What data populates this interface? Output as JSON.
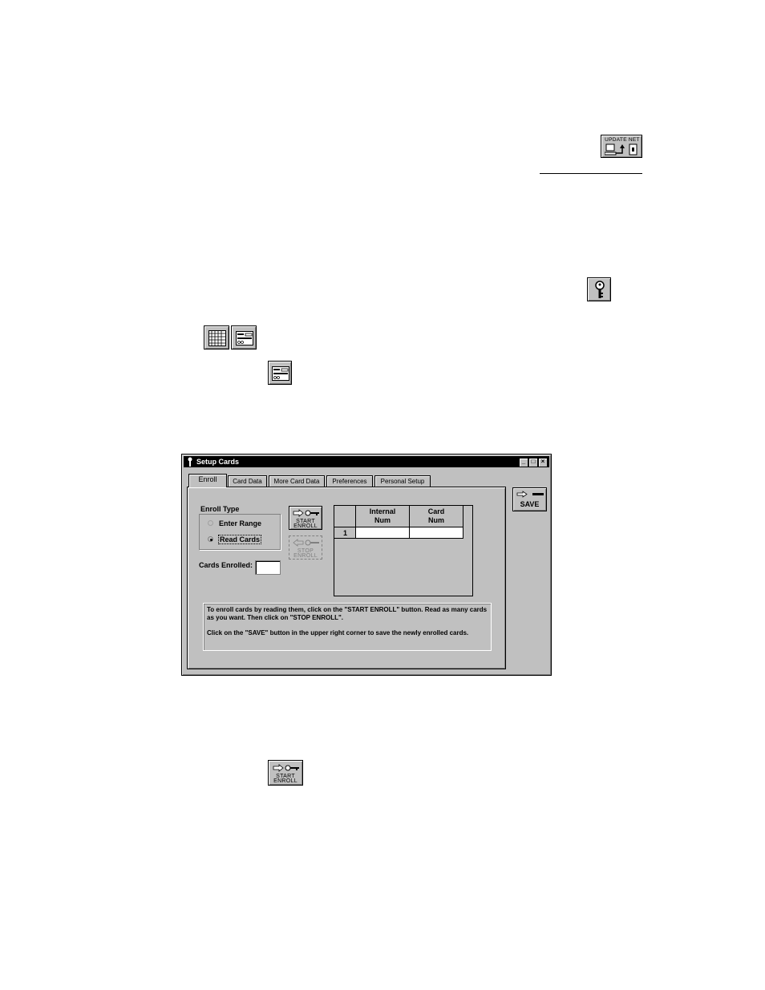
{
  "icons": {
    "update_net_label": "UPDATE NET",
    "start_enroll_line1": "START",
    "start_enroll_line2": "ENROLL"
  },
  "window": {
    "title": "Setup Cards",
    "controls": {
      "minimize": "_",
      "maximize": "□",
      "close": "×"
    },
    "tabs": [
      {
        "label": "Enroll"
      },
      {
        "label": "Card Data"
      },
      {
        "label": "More Card Data"
      },
      {
        "label": "Preferences"
      },
      {
        "label": "Personal Setup"
      }
    ],
    "save_label": "SAVE",
    "enroll_type": {
      "title": "Enroll Type",
      "options": [
        {
          "label": "Enter Range",
          "selected": false
        },
        {
          "label": "Read Cards",
          "selected": true
        }
      ]
    },
    "start_enroll": {
      "line1": "START",
      "line2": "ENROLL"
    },
    "stop_enroll": {
      "line1": "STOP",
      "line2": "ENROLL"
    },
    "cards_enrolled": {
      "label": "Cards Enrolled:",
      "value": ""
    },
    "grid": {
      "columns": [
        {
          "line1": "Internal",
          "line2": "Num"
        },
        {
          "line1": "Card",
          "line2": "Num"
        }
      ],
      "rows": [
        {
          "index": "1",
          "internal": "",
          "card": ""
        }
      ]
    },
    "info": {
      "para1": "To enroll cards by reading them, click on the \"START ENROLL\" button.  Read as many cards as you want.  Then click on \"STOP ENROLL\".",
      "para2": "Click on the \"SAVE\" button in the upper right corner to save the newly enrolled cards."
    }
  }
}
